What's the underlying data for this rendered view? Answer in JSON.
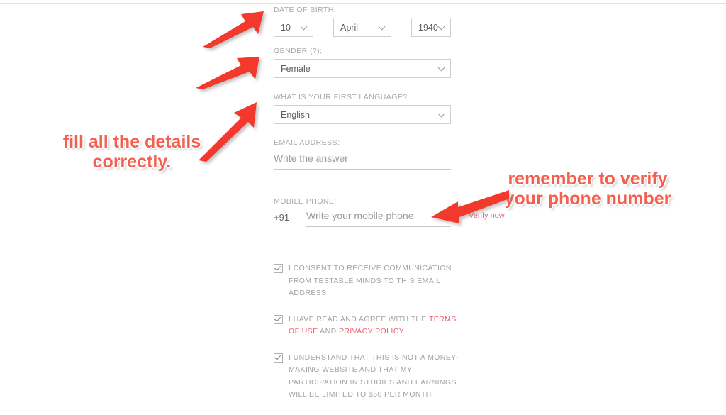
{
  "form": {
    "dob": {
      "label": "DATE OF BIRTH:",
      "day": "10",
      "month": "April",
      "year": "1940"
    },
    "gender": {
      "label": "GENDER (?):",
      "value": "Female"
    },
    "language": {
      "label": "WHAT IS YOUR FIRST LANGUAGE?",
      "value": "English"
    },
    "email": {
      "label": "EMAIL ADDRESS:",
      "placeholder": "Write the answer",
      "value": ""
    },
    "phone": {
      "label": "MOBILE PHONE:",
      "country_code": "+91",
      "placeholder": "Write your mobile phone",
      "value": "",
      "verify_link": "Verify now"
    }
  },
  "consents": [
    {
      "text_before": "I CONSENT TO RECEIVE COMMUNICATION FROM TESTABLE MINDS TO THIS EMAIL ADDRESS",
      "checked": true
    },
    {
      "text_before": "I HAVE READ AND AGREE WITH THE ",
      "link1": "TERMS OF USE",
      "text_middle": " AND ",
      "link2": "PRIVACY POLICY",
      "checked": true
    },
    {
      "text_before": "I UNDERSTAND THAT THIS IS NOT A MONEY-MAKING WEBSITE AND THAT MY PARTICIPATION IN STUDIES AND EARNINGS WILL BE LIMITED TO $50 PER MONTH",
      "checked": true
    }
  ],
  "annotations": {
    "left": "fill all the details\ncorrectly.",
    "right": "remember to verify\nyour phone number",
    "color": "#f4604f"
  },
  "colors": {
    "link": "#ef5f74",
    "label": "#a8a8a8",
    "annotation": "#f4604f",
    "border": "#cfcfcf"
  }
}
